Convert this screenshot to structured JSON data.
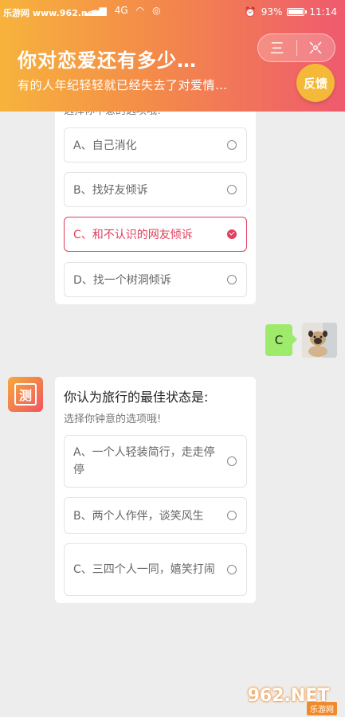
{
  "statusbar": {
    "site": "乐游网 www.962.net",
    "signal_text": "4G",
    "battery_pct": "93%",
    "time": "11:14"
  },
  "header": {
    "title": "你对恋爱还有多少…",
    "subtitle": "有的人年纪轻轻就已经失去了对爱情…",
    "menu_label": "三",
    "close_label": "✕",
    "feedback_label": "反馈"
  },
  "prev_question": {
    "partial_hint": "选择你中意的选项哦!",
    "options": [
      {
        "label": "A、自己消化",
        "selected": false
      },
      {
        "label": "B、找好友倾诉",
        "selected": false
      },
      {
        "label": "C、和不认识的网友倾诉",
        "selected": true
      },
      {
        "label": "D、找一个树洞倾诉",
        "selected": false
      }
    ]
  },
  "user_reply": {
    "text": "C"
  },
  "bot_avatar_label": "测",
  "current_question": {
    "title": "你认为旅行的最佳状态是:",
    "hint": "选择你钟意的选项哦!",
    "options": [
      {
        "label": "A、一个人轻装简行，走走停停",
        "selected": false
      },
      {
        "label": "B、两个人作伴，谈笑风生",
        "selected": false
      },
      {
        "label": "C、三四个人一同，嬉笑打闹",
        "selected": false
      }
    ]
  },
  "watermark": {
    "main": "962.NET",
    "sub": "乐游网"
  },
  "colors": {
    "accent": "#e0405e",
    "header_start": "#f7b33c",
    "header_end": "#ef5a6e",
    "bubble": "#9eea6a"
  }
}
